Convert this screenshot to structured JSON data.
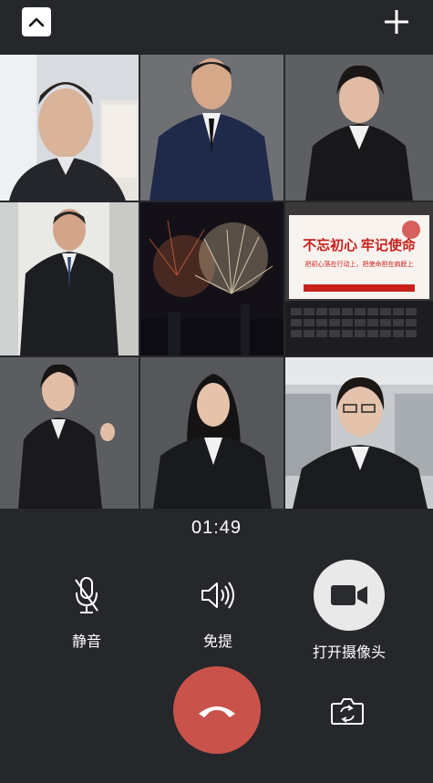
{
  "call": {
    "timer": "01:49"
  },
  "controls": {
    "mute_label": "静音",
    "speaker_label": "免提",
    "camera_label": "打开摄像头"
  },
  "participants": [
    {
      "tile": "participant-1"
    },
    {
      "tile": "participant-2"
    },
    {
      "tile": "participant-3"
    },
    {
      "tile": "participant-4"
    },
    {
      "tile": "participant-5"
    },
    {
      "tile": "participant-6"
    },
    {
      "tile": "participant-7"
    },
    {
      "tile": "participant-8"
    },
    {
      "tile": "participant-9"
    }
  ],
  "tile6_banner": {
    "headline": "不忘初心 牢记使命",
    "subline": "把初心落在行动上，把使命担在肩膀上"
  },
  "colors": {
    "background": "#25272b",
    "hangup": "#c9524b",
    "camera_button": "#e9e9ea"
  }
}
